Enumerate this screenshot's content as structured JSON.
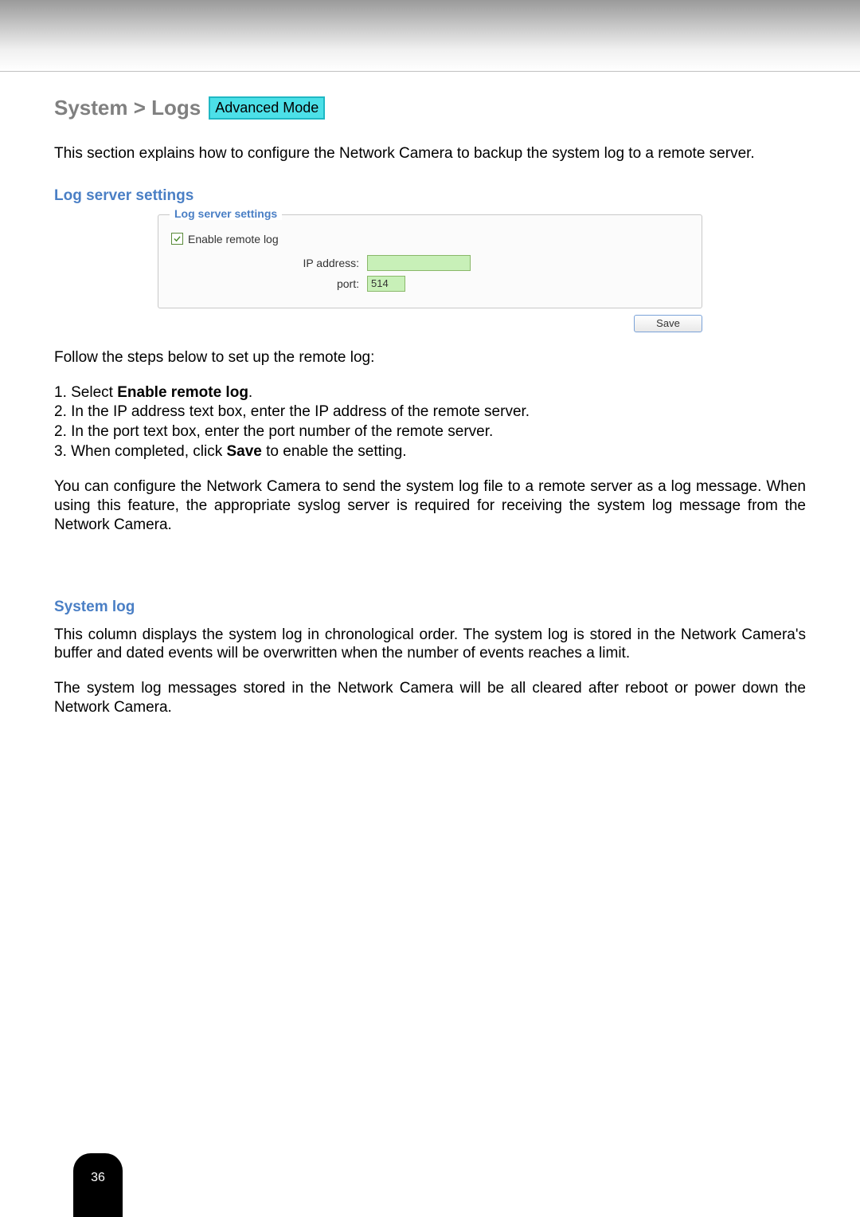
{
  "breadcrumb": "System > Logs",
  "mode_badge": "Advanced Mode",
  "intro": "This section explains how to configure the Network Camera to backup the system log to a remote server.",
  "section1": {
    "heading": "Log server settings",
    "fieldset_legend": "Log server settings",
    "enable_checkbox_label": "Enable remote log",
    "enable_checked": true,
    "ip_label": "IP address:",
    "ip_value": "",
    "port_label": "port:",
    "port_value": "514",
    "save_button": "Save"
  },
  "steps_intro": "Follow the steps below to set up the remote log:",
  "steps": {
    "line1_prefix": "1. Select ",
    "line1_bold": "Enable remote log",
    "line1_suffix": ".",
    "line2": "2. In the IP address text box, enter the IP address of the remote server.",
    "line3": "2. In the port text box, enter the port number of the remote server.",
    "line4_prefix": "3. When completed, click ",
    "line4_bold": "Save",
    "line4_suffix": " to enable the setting."
  },
  "paragraph_after_steps": "You can configure the Network Camera to send the system log file to a remote server as a log message. When using this feature, the appropriate syslog server is required for receiving the system log message from the Network Camera.",
  "section2": {
    "heading": "System log",
    "p1": "This column displays the system log in chronological order. The system log is stored in the Network Camera's buffer and dated events will be overwritten when the number of events reaches a limit.",
    "p2": "The system log messages stored in the Network Camera will be all cleared after reboot or power down the Network Camera."
  },
  "page_number": "36"
}
